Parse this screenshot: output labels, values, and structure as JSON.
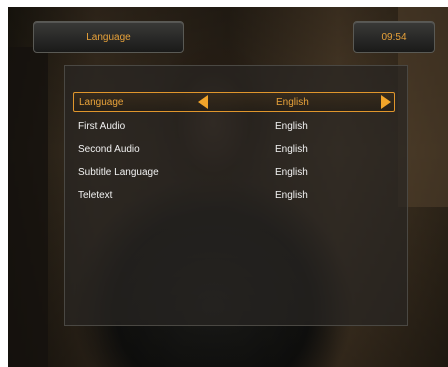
{
  "header": {
    "title": "Language",
    "clock": "09:54"
  },
  "settings": [
    {
      "label": "Language",
      "value": "English",
      "selected": true
    },
    {
      "label": "First Audio",
      "value": "English",
      "selected": false
    },
    {
      "label": "Second Audio",
      "value": "English",
      "selected": false
    },
    {
      "label": "Subtitle Language",
      "value": "English",
      "selected": false
    },
    {
      "label": "Teletext",
      "value": "English",
      "selected": false
    }
  ],
  "icons": {
    "prev": "left-arrow-icon",
    "next": "right-arrow-icon"
  },
  "colors": {
    "accent": "#e8a23a",
    "text": "#f2f2f2"
  }
}
